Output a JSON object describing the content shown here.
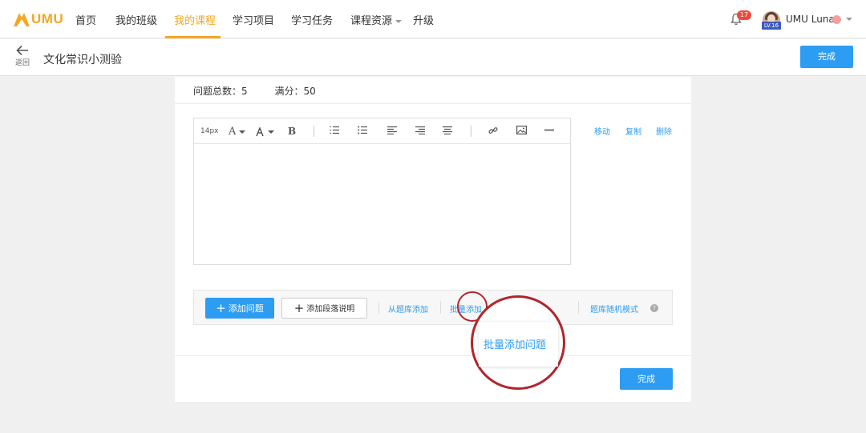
{
  "nav": {
    "logo_text": "UMU",
    "items": [
      "首页",
      "我的班级",
      "我的课程",
      "学习项目",
      "学习任务",
      "课程资源",
      "升级"
    ],
    "active_index": 2,
    "notifications": "17",
    "level": "LV.16",
    "user": "UMU Luna"
  },
  "subheader": {
    "back_label": "返回",
    "title": "文化常识小测验",
    "done_label": "完成"
  },
  "summary": {
    "questions": "问题总数：5",
    "score": "满分：50"
  },
  "editor": {
    "font_size": "14px",
    "question_actions": [
      "移动",
      "复制",
      "删除"
    ]
  },
  "actions": {
    "add_question": "添加问题",
    "add_paragraph": "添加段落说明",
    "from_bank": "从题库添加",
    "batch_add": "批量添加",
    "random_mode": "题库随机模式",
    "batch_popup": "批量添加问题"
  },
  "footer": {
    "done_label": "完成"
  },
  "colors": {
    "accent": "#f5a623",
    "primary": "#2d9cf3",
    "highlight": "#b0262c"
  }
}
